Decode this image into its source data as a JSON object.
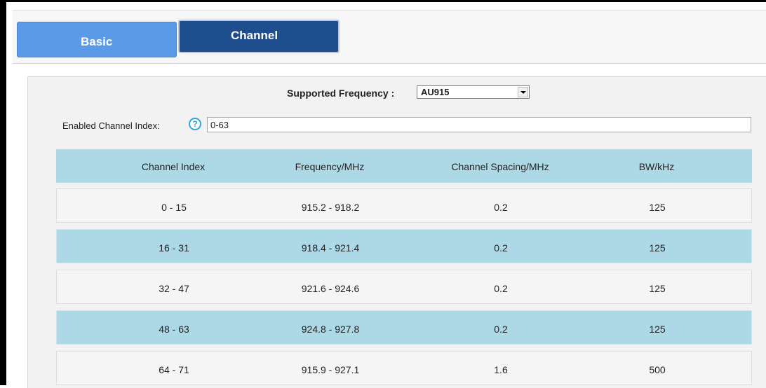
{
  "tabs": {
    "basic_label": "Basic",
    "channel_label": "Channel"
  },
  "frequency": {
    "label": "Supported Frequency :",
    "selected": "AU915"
  },
  "channel_index": {
    "label": "Enabled Channel Index:",
    "help_glyph": "?",
    "value": "0-63"
  },
  "table": {
    "headers": [
      "Channel Index",
      "Frequency/MHz",
      "Channel Spacing/MHz",
      "BW/kHz"
    ],
    "rows": [
      [
        "0 - 15",
        "915.2 - 918.2",
        "0.2",
        "125"
      ],
      [
        "16 - 31",
        "918.4 - 921.4",
        "0.2",
        "125"
      ],
      [
        "32 - 47",
        "921.6 - 924.6",
        "0.2",
        "125"
      ],
      [
        "48 - 63",
        "924.8 - 927.8",
        "0.2",
        "125"
      ],
      [
        "64 - 71",
        "915.9 - 927.1",
        "1.6",
        "500"
      ]
    ]
  },
  "colors": {
    "tab_basic": "#5b9ae6",
    "tab_channel_active": "#1f4e8f",
    "header_row": "#add8e6",
    "alt_row": "#add8e6",
    "help_icon": "#2fa8d8"
  }
}
